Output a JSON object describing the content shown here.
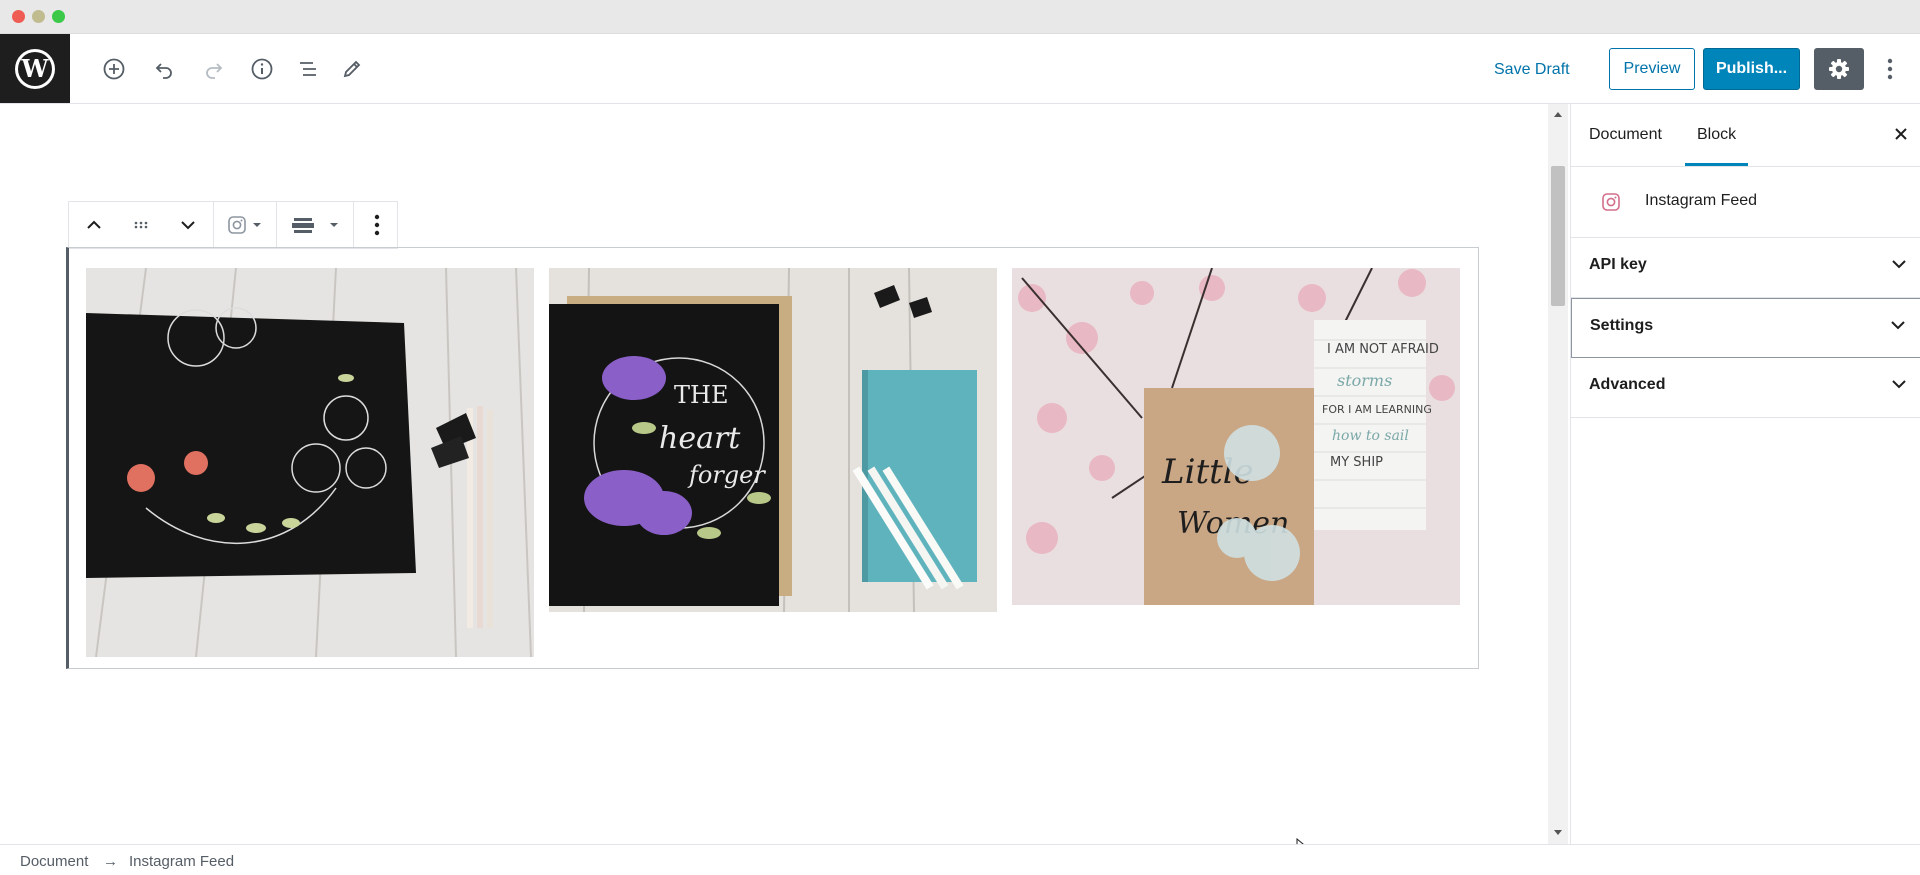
{
  "window": {
    "controls": [
      "close",
      "minimize",
      "maximize"
    ]
  },
  "toolbar": {
    "logo_icon": "wordpress-logo-icon",
    "icons": [
      "add-block-icon",
      "undo-icon",
      "redo-icon",
      "info-icon",
      "block-navigation-icon",
      "edit-tools-icon"
    ],
    "save_draft_label": "Save Draft",
    "preview_label": "Preview",
    "publish_label": "Publish...",
    "settings_icon": "gear-icon",
    "more_icon": "more-vertical-icon"
  },
  "block_toolbar": {
    "icons": [
      "chevron-up-icon",
      "drag-handle-icon",
      "chevron-down-icon",
      "instagram-icon",
      "align-icon",
      "more-vertical-icon"
    ]
  },
  "gallery": {
    "images": [
      {
        "alt": "black sketchbook with floral wreath"
      },
      {
        "alt": "the heart-forger notebook with purple flowers"
      },
      {
        "alt": "little women notebook with cherry blossoms"
      }
    ]
  },
  "sidebar": {
    "tabs": [
      {
        "label": "Document"
      },
      {
        "label": "Block",
        "active": true
      }
    ],
    "block_card": {
      "icon": "instagram-icon",
      "title": "Instagram Feed"
    },
    "panels": [
      {
        "label": "API key"
      },
      {
        "label": "Settings"
      },
      {
        "label": "Advanced"
      }
    ]
  },
  "footer": {
    "crumbs": [
      "Document",
      "Instagram Feed"
    ],
    "separator": "→"
  },
  "colors": {
    "accent": "#0085ba",
    "link": "#0073aa",
    "dark": "#1e1e1e"
  }
}
